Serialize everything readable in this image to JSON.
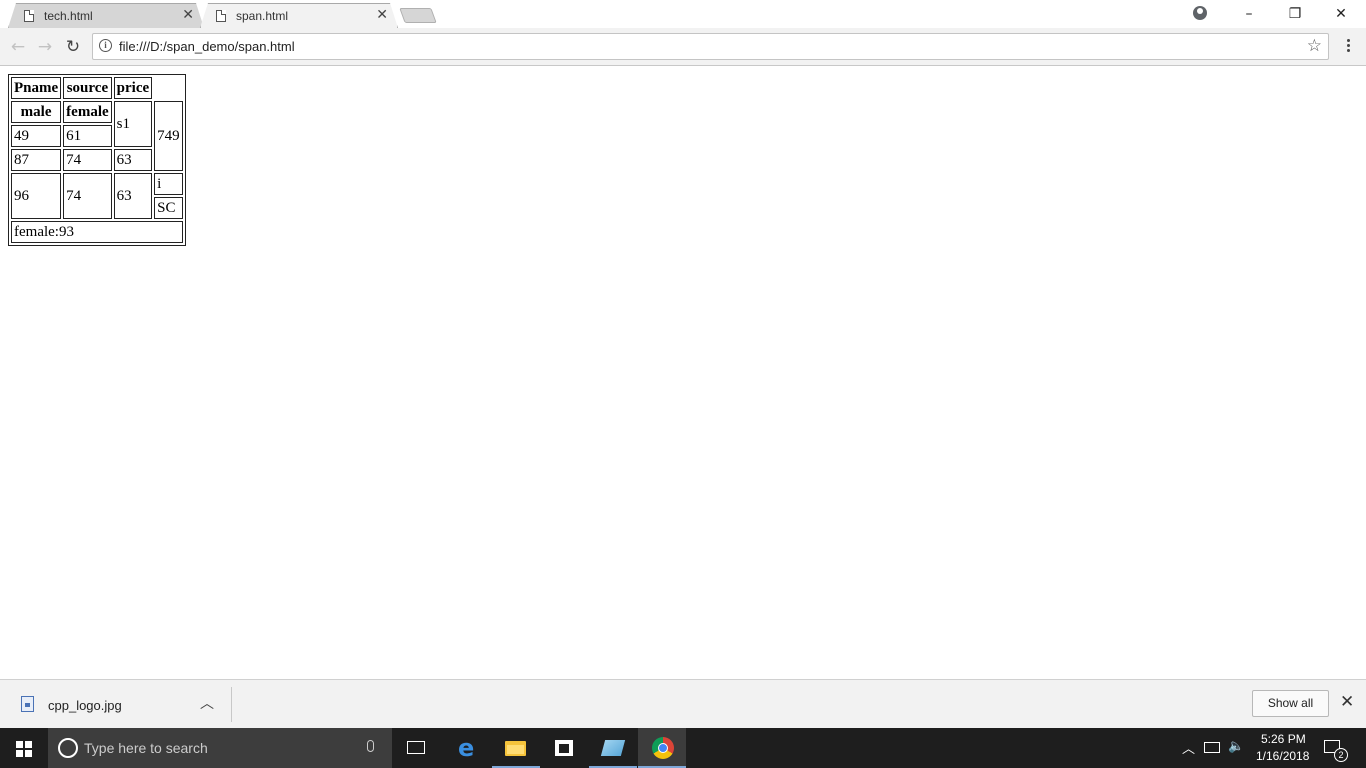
{
  "browser": {
    "tabs": [
      {
        "title": "tech.html",
        "active": false
      },
      {
        "title": "span.html",
        "active": true
      }
    ],
    "close_glyph": "✕",
    "address": "file:///D:/span_demo/span.html",
    "window_controls": {
      "minimize": "–",
      "restore": "❐",
      "close": "✕"
    }
  },
  "page": {
    "header": [
      "Pname",
      "source",
      "price"
    ],
    "subheader": [
      "male",
      "female"
    ],
    "s1": "s1",
    "total": "749",
    "rows": [
      [
        "49",
        "61"
      ],
      [
        "87",
        "74",
        "63"
      ],
      [
        "96",
        "74",
        "63"
      ]
    ],
    "i_cell": "i",
    "sc_cell": "SC",
    "footer": "female:93"
  },
  "download_bar": {
    "file_name": "cpp_logo.jpg",
    "show_all": "Show all"
  },
  "taskbar": {
    "search_placeholder": "Type here to search",
    "time": "5:26 PM",
    "date": "1/16/2018",
    "notification_count": "2"
  },
  "colors": {
    "taskbar": "#1e1e1e",
    "toolbar": "#f2f2f2",
    "active_indicator": "#7ea7d8"
  }
}
